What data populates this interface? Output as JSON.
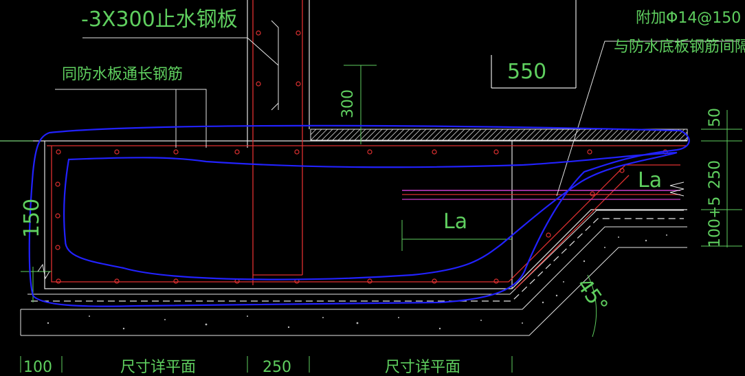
{
  "labels": {
    "steel_plate": "-3X300止水钢板",
    "through_rebar": "同防水板通长钢筋",
    "dim_550": "550",
    "add_rebar": "附加Φ14@150",
    "add_rebar_note": "与防水底板钢筋间隔布置",
    "dim_300": "300",
    "dim_50": "50",
    "dim_250_right": "250",
    "dim_100_5": "100+5",
    "dim_150": "150",
    "la_left": "La",
    "la_right": "La",
    "angle_45": "45°",
    "bottom_100": "100",
    "bottom_text1": "尺寸详平面",
    "bottom_250": "250",
    "bottom_text2": "尺寸详平面"
  },
  "colors": {
    "background": "#000000",
    "green": "#5fcf5f",
    "white": "#e6e6e6",
    "red": "#e03030",
    "blue": "#2020ff",
    "magenta": "#d040d0",
    "dark_fill": "#333333"
  }
}
